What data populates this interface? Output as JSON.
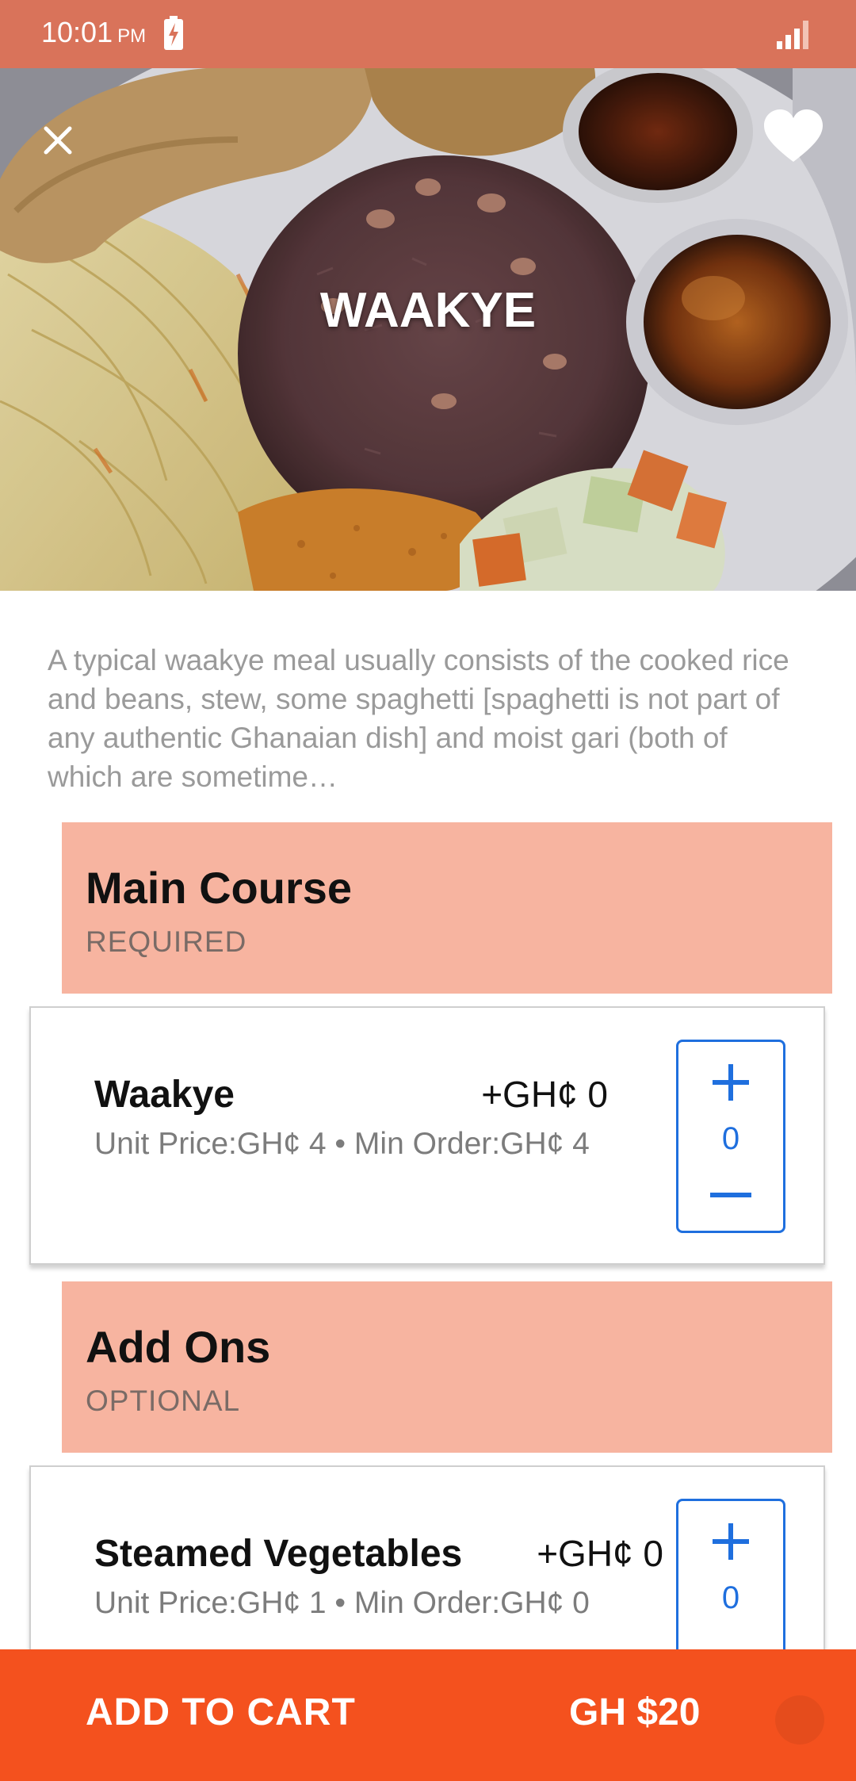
{
  "status_bar": {
    "time": "10:01",
    "ampm": "PM"
  },
  "hero": {
    "title": "WAAKYE"
  },
  "description": "A typical waakye meal usually consists of the cooked rice and beans, stew, some spaghetti [spaghetti is not part of any authentic Ghanaian dish] and moist gari (both of which are sometime…",
  "sections": [
    {
      "title": "Main Course",
      "subtitle": "REQUIRED",
      "item": {
        "name": "Waakye",
        "price": "+GH¢ 0",
        "meta": "Unit Price:GH¢ 4 • Min Order:GH¢ 4",
        "quantity": "0"
      }
    },
    {
      "title": "Add Ons",
      "subtitle": "OPTIONAL",
      "item": {
        "name": "Steamed Vegetables",
        "price": "+GH¢ 0",
        "meta": "Unit Price:GH¢ 1 • Min Order:GH¢ 0",
        "quantity": "0"
      }
    }
  ],
  "bottom_bar": {
    "cart_label": "ADD TO CART",
    "total": "GH $20"
  },
  "colors": {
    "status_bar": "#d9735a",
    "section_header": "#f7b4a0",
    "accent_blue": "#1f6fde",
    "bottom_bar": "#f4511e"
  },
  "icons": [
    "battery-charging-icon",
    "signal-icon",
    "close-icon",
    "heart-icon",
    "plus-icon",
    "minus-icon"
  ]
}
